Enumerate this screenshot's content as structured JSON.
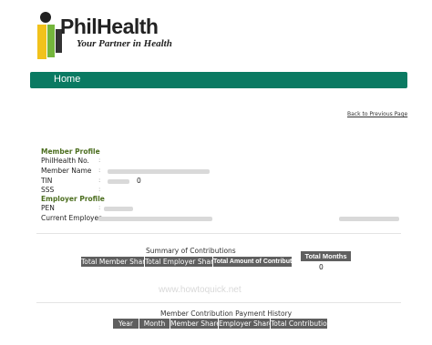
{
  "brand": {
    "name": "PhilHealth",
    "tagline": "Your Partner in Health"
  },
  "nav": {
    "home_label": "Home"
  },
  "back_link": "Back to Previous Page",
  "member_profile": {
    "title": "Member Profile",
    "fields": [
      {
        "label": "PhilHealth No.",
        "value": ""
      },
      {
        "label": "Member Name",
        "value": ""
      },
      {
        "label": "TIN",
        "value": "0"
      },
      {
        "label": "SSS",
        "value": ""
      }
    ]
  },
  "employer_profile": {
    "title": "Employer Profile",
    "fields": [
      {
        "label": "PEN",
        "value": ""
      },
      {
        "label": "Current Employer",
        "value": ""
      }
    ]
  },
  "summary": {
    "title": "Summary of Contributions",
    "headers": [
      "Total Member Share",
      "Total Employer Share",
      "Total Amount of Contribution",
      "Total Months"
    ],
    "total_months_value": "0"
  },
  "watermark": "www.howtoquick.net",
  "history": {
    "title": "Member Contribution Payment History",
    "headers": [
      "Year",
      "Month",
      "Member Share",
      "Employer Share",
      "Total Contribution"
    ]
  },
  "colors": {
    "nav_bg": "#0a7a62",
    "section_title": "#4c6e1f",
    "table_header_bg": "#5f5f5f",
    "logo_green": "#74b63c",
    "logo_yellow": "#f2c21b"
  }
}
